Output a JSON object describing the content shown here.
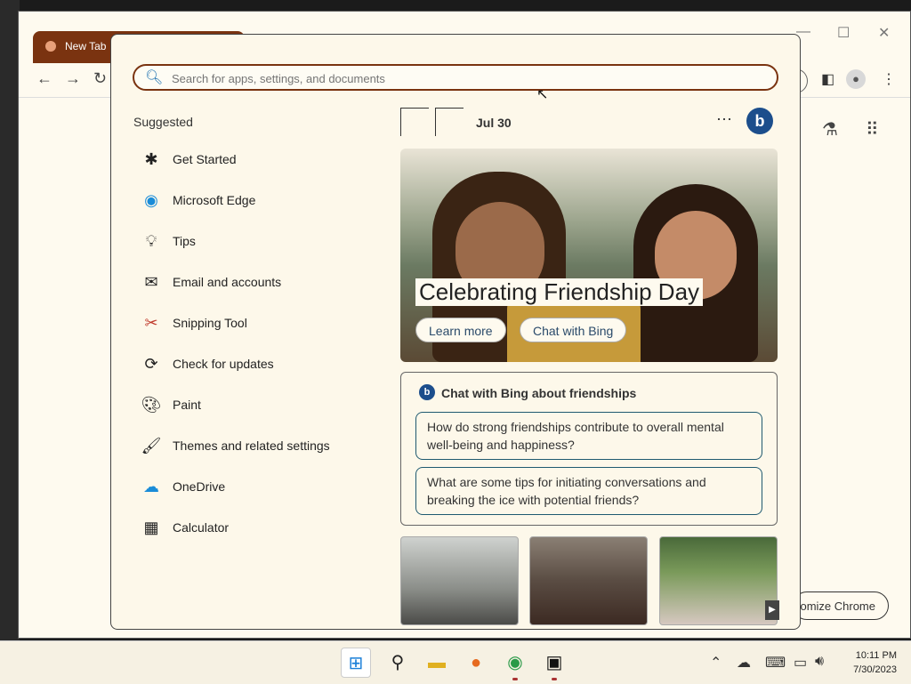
{
  "chrome": {
    "tab_title": "New Tab",
    "customize_label": "omize Chrome"
  },
  "start_menu": {
    "search": {
      "placeholder": "Search for apps, settings, and documents"
    },
    "suggested_heading": "Suggested",
    "apps": [
      {
        "label": "Get Started",
        "icon": "get-started-icon"
      },
      {
        "label": "Microsoft Edge",
        "icon": "edge-icon"
      },
      {
        "label": "Tips",
        "icon": "tips-bulb-icon"
      },
      {
        "label": "Email and accounts",
        "icon": "mail-icon"
      },
      {
        "label": "Snipping Tool",
        "icon": "snipping-tool-icon"
      },
      {
        "label": "Check for updates",
        "icon": "refresh-icon"
      },
      {
        "label": "Paint",
        "icon": "paint-palette-icon"
      },
      {
        "label": "Themes and related settings",
        "icon": "brush-icon"
      },
      {
        "label": "OneDrive",
        "icon": "onedrive-icon"
      },
      {
        "label": "Calculator",
        "icon": "calculator-icon"
      }
    ],
    "widgets": {
      "date": "Jul 30",
      "hero_title": "Celebrating Friendship Day",
      "learn_more": "Learn more",
      "chat_with_bing": "Chat with Bing",
      "chat_card": {
        "title": "Chat with Bing about friendships",
        "questions": [
          "How do strong friendships contribute to overall mental well-being and happiness?",
          "What are some tips for initiating conversations and breaking the ice with potential friends?"
        ]
      }
    }
  },
  "taskbar": {
    "time": "10:11 PM",
    "date": "7/30/2023"
  },
  "colors": {
    "accent": "#7a3310",
    "bing_blue": "#1c4e8c",
    "background": "#fefaef"
  }
}
